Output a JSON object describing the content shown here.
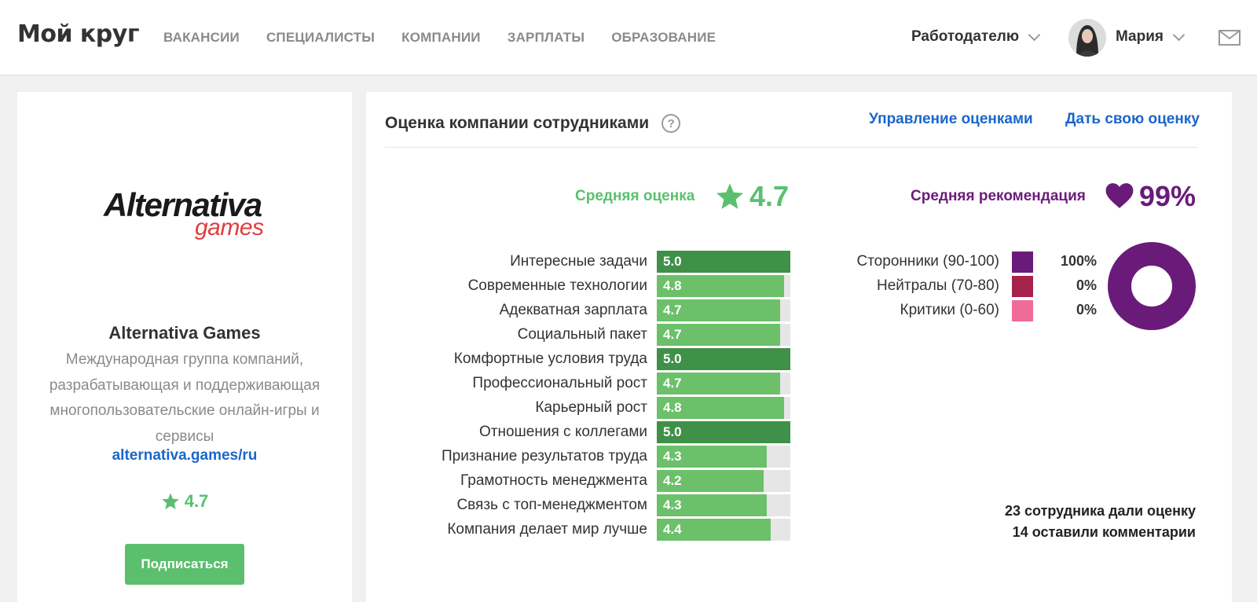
{
  "header": {
    "logo": "Мой круг",
    "nav": [
      "ВАКАНСИИ",
      "СПЕЦИАЛИСТЫ",
      "КОМПАНИИ",
      "ЗАРПЛАТЫ",
      "ОБРАЗОВАНИЕ"
    ],
    "employer": "Работодателю",
    "user_name": "Мария",
    "icons": {
      "avatar": "user-avatar",
      "mail": "mail-icon",
      "dropdown": "chevron-down-icon"
    }
  },
  "company": {
    "logo_main": "Alternativa",
    "logo_sub": "games",
    "name": "Alternativa Games",
    "description": "Международная группа компаний, разрабатывающая и поддерживающая многопользовательские онлайн-игры и сервисы",
    "link": "alternativa.games/ru",
    "rating": "4.7",
    "subscribe_label": "Подписаться"
  },
  "ratings": {
    "title": "Оценка компании сотрудниками",
    "manage_link": "Управление оценками",
    "give_link": "Дать свою оценку",
    "average_label": "Средняя оценка",
    "average_value": "4.7",
    "recommend_label": "Средняя рекомендация",
    "recommend_value": "99%",
    "criteria": [
      {
        "label": "Интересные задачи",
        "value": "5.0"
      },
      {
        "label": "Современные технологии",
        "value": "4.8"
      },
      {
        "label": "Адекватная зарплата",
        "value": "4.7"
      },
      {
        "label": "Социальный пакет",
        "value": "4.7"
      },
      {
        "label": "Комфортные условия труда",
        "value": "5.0"
      },
      {
        "label": "Профессиональный рост",
        "value": "4.7"
      },
      {
        "label": "Карьерный рост",
        "value": "4.8"
      },
      {
        "label": "Отношения с коллегами",
        "value": "5.0"
      },
      {
        "label": "Признание результатов труда",
        "value": "4.3"
      },
      {
        "label": "Грамотность менеджмента",
        "value": "4.2"
      },
      {
        "label": "Связь с топ-менеджментом",
        "value": "4.3"
      },
      {
        "label": "Компания делает мир лучше",
        "value": "4.4"
      }
    ],
    "recommendation_breakdown": [
      {
        "label": "Сторонники (90-100)",
        "value": "100%",
        "color": "#6a1b7a"
      },
      {
        "label": "Нейтралы (70-80)",
        "value": "0%",
        "color": "#a5234a"
      },
      {
        "label": "Критики (0-60)",
        "value": "0%",
        "color": "#f06a9a"
      }
    ],
    "summary_line1": "23 сотрудника дали оценку",
    "summary_line2": "14 оставили комментарии"
  },
  "colors": {
    "accent_green": "#5bbf6e",
    "full_score_green": "#3f9048",
    "purple": "#6a1b7a",
    "link_blue": "#1a66cc"
  }
}
